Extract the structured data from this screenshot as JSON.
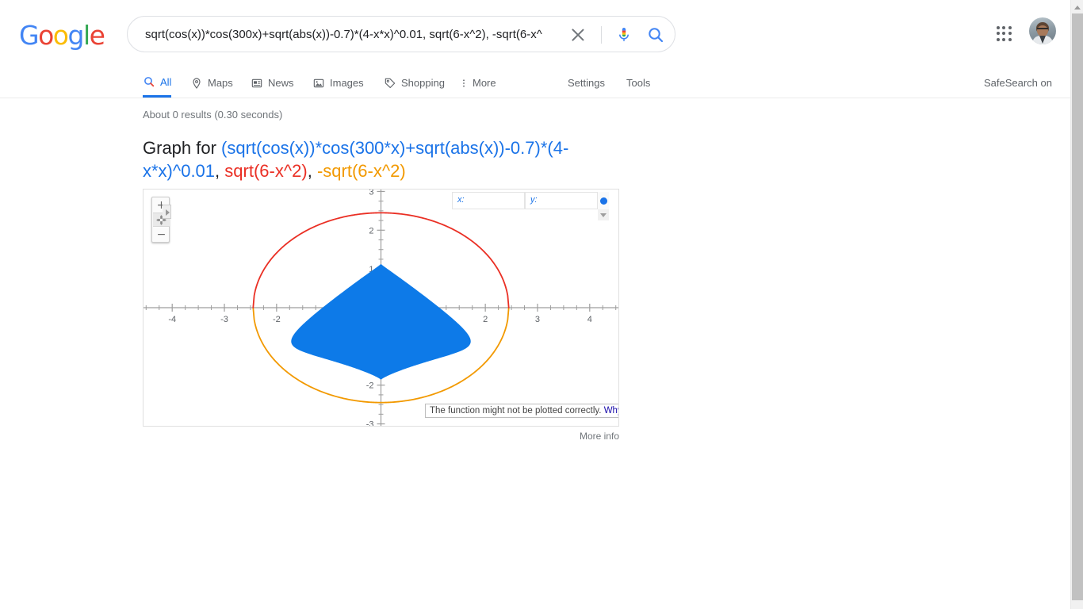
{
  "browser": {
    "scrollbar": {
      "name": "vertical-scrollbar",
      "up_arrow": "▲"
    }
  },
  "header": {
    "logo": {
      "letters": [
        "G",
        "o",
        "o",
        "g",
        "l",
        "e"
      ],
      "alt": "Google"
    },
    "search": {
      "value": "sqrt(cos(x))*cos(300x)+sqrt(abs(x))-0.7)*(4-x*x)^0.01, sqrt(6-x^2), -sqrt(6-x^",
      "placeholder": "Search",
      "clear_icon": "close-icon",
      "mic_icon": "microphone-icon",
      "search_icon": "search-icon"
    },
    "apps_icon": "apps-grid-icon",
    "avatar_label": "Google Account"
  },
  "nav": {
    "tabs": [
      {
        "label": "All",
        "icon": "search-icon",
        "active": true
      },
      {
        "label": "Maps",
        "icon": "pin-icon",
        "active": false
      },
      {
        "label": "News",
        "icon": "news-icon",
        "active": false
      },
      {
        "label": "Images",
        "icon": "image-icon",
        "active": false
      },
      {
        "label": "Shopping",
        "icon": "tag-icon",
        "active": false
      },
      {
        "label": "More",
        "icon": "kebab-icon",
        "active": false
      }
    ],
    "settings_label": "Settings",
    "tools_label": "Tools",
    "safesearch_label": "SafeSearch on"
  },
  "results": {
    "count_text": "About 0 results (0.30 seconds)",
    "title_prefix": "Graph for ",
    "functions": [
      {
        "text": "(sqrt(cos(x))*cos(300*x)+sqrt(abs(x))-0.7)*(4-x*x)^0.01",
        "color": "#1a73e8"
      },
      {
        "text": "sqrt(6-x^2)",
        "color": "#ea2f24"
      },
      {
        "text": "-sqrt(6-x^2)",
        "color": "#f29900"
      }
    ],
    "separator": ", ",
    "more_info_label": "More info"
  },
  "graph": {
    "zoom_in_label": "+",
    "zoom_out_label": "−",
    "pan_icon": "pan-move-icon",
    "pan_expand_icon": "chevron-right-icon",
    "coord_x_label": "x:",
    "coord_y_label": "y:",
    "coord_x_value": "",
    "coord_y_value": "",
    "legend_dot_color": "#1a73e8",
    "expand_icon": "chevron-down-icon",
    "warning_text": "The function might not be plotted correctly.",
    "warning_link": "Why?"
  },
  "chart_data": {
    "type": "line",
    "title": "Graph for (sqrt(cos(x))*cos(300*x)+sqrt(abs(x))-0.7)*(4-x*x)^0.01, sqrt(6-x^2), -sqrt(6-x^2)",
    "xlabel": "",
    "ylabel": "",
    "xlim": [
      -4.55,
      4.55
    ],
    "ylim": [
      -3.05,
      3.05
    ],
    "xticks": [
      -4,
      -3,
      -2,
      -1,
      1,
      2,
      3,
      4
    ],
    "yticks": [
      3,
      2,
      1,
      -1,
      -2,
      -3
    ],
    "xtick_labels_visible": [
      "-4",
      "-3",
      "-2",
      "2",
      "3",
      "4"
    ],
    "ytick_labels_visible": [
      "3",
      "2",
      "1",
      "-2",
      "-3"
    ],
    "grid": false,
    "legend": "none",
    "axis_color": "#9e9e9e",
    "minor_tick_step": 0.25,
    "series": [
      {
        "name": "(sqrt(cos(x))*cos(300*x)+sqrt(abs(x))-0.7)*(4-x*x)^0.01",
        "color": "#0d7ae8",
        "render": "heart-fill",
        "domain": [
          -1.7,
          1.7
        ],
        "range": [
          -1.85,
          1.12
        ],
        "description": "Dense oscillating curve filling a heart-shaped region; top lobes peak near y=1.05 at x=±0.7, cusp at (0, 0.45), bottom tip at (0, -1.85)"
      },
      {
        "name": "sqrt(6-x^2)",
        "color": "#ea2f24",
        "render": "semicircle-upper",
        "domain": [
          -2.449,
          2.449
        ],
        "radius": 2.449,
        "points": [
          {
            "x": -2.449,
            "y": 0
          },
          {
            "x": -2.0,
            "y": 1.414
          },
          {
            "x": -1.5,
            "y": 1.936
          },
          {
            "x": -1.0,
            "y": 2.236
          },
          {
            "x": 0,
            "y": 2.449
          },
          {
            "x": 1.0,
            "y": 2.236
          },
          {
            "x": 1.5,
            "y": 1.936
          },
          {
            "x": 2.0,
            "y": 1.414
          },
          {
            "x": 2.449,
            "y": 0
          }
        ]
      },
      {
        "name": "-sqrt(6-x^2)",
        "color": "#f29900",
        "render": "semicircle-lower",
        "domain": [
          -2.449,
          2.449
        ],
        "radius": 2.449,
        "points": [
          {
            "x": -2.449,
            "y": 0
          },
          {
            "x": -2.0,
            "y": -1.414
          },
          {
            "x": -1.5,
            "y": -1.936
          },
          {
            "x": -1.0,
            "y": -2.236
          },
          {
            "x": 0,
            "y": -2.449
          },
          {
            "x": 1.0,
            "y": -2.236
          },
          {
            "x": 1.5,
            "y": -1.936
          },
          {
            "x": 2.0,
            "y": -1.414
          },
          {
            "x": 2.449,
            "y": 0
          }
        ]
      }
    ]
  }
}
